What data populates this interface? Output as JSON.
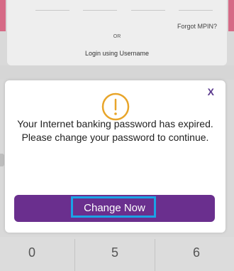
{
  "background": {
    "forgot_mpin": "Forgot MPIN?",
    "or": "OR",
    "login_username": "Login using Username",
    "keypad": [
      "0",
      "5",
      "6"
    ]
  },
  "dialog": {
    "close": "X",
    "icon": "alert-circle-icon",
    "message": "Your Internet banking password has expired. Please change your password to continue.",
    "button_label": "Change Now"
  },
  "colors": {
    "accent_purple": "#6a2f8e",
    "alert_orange": "#e8a52a",
    "highlight_blue": "#1aa3e6"
  }
}
